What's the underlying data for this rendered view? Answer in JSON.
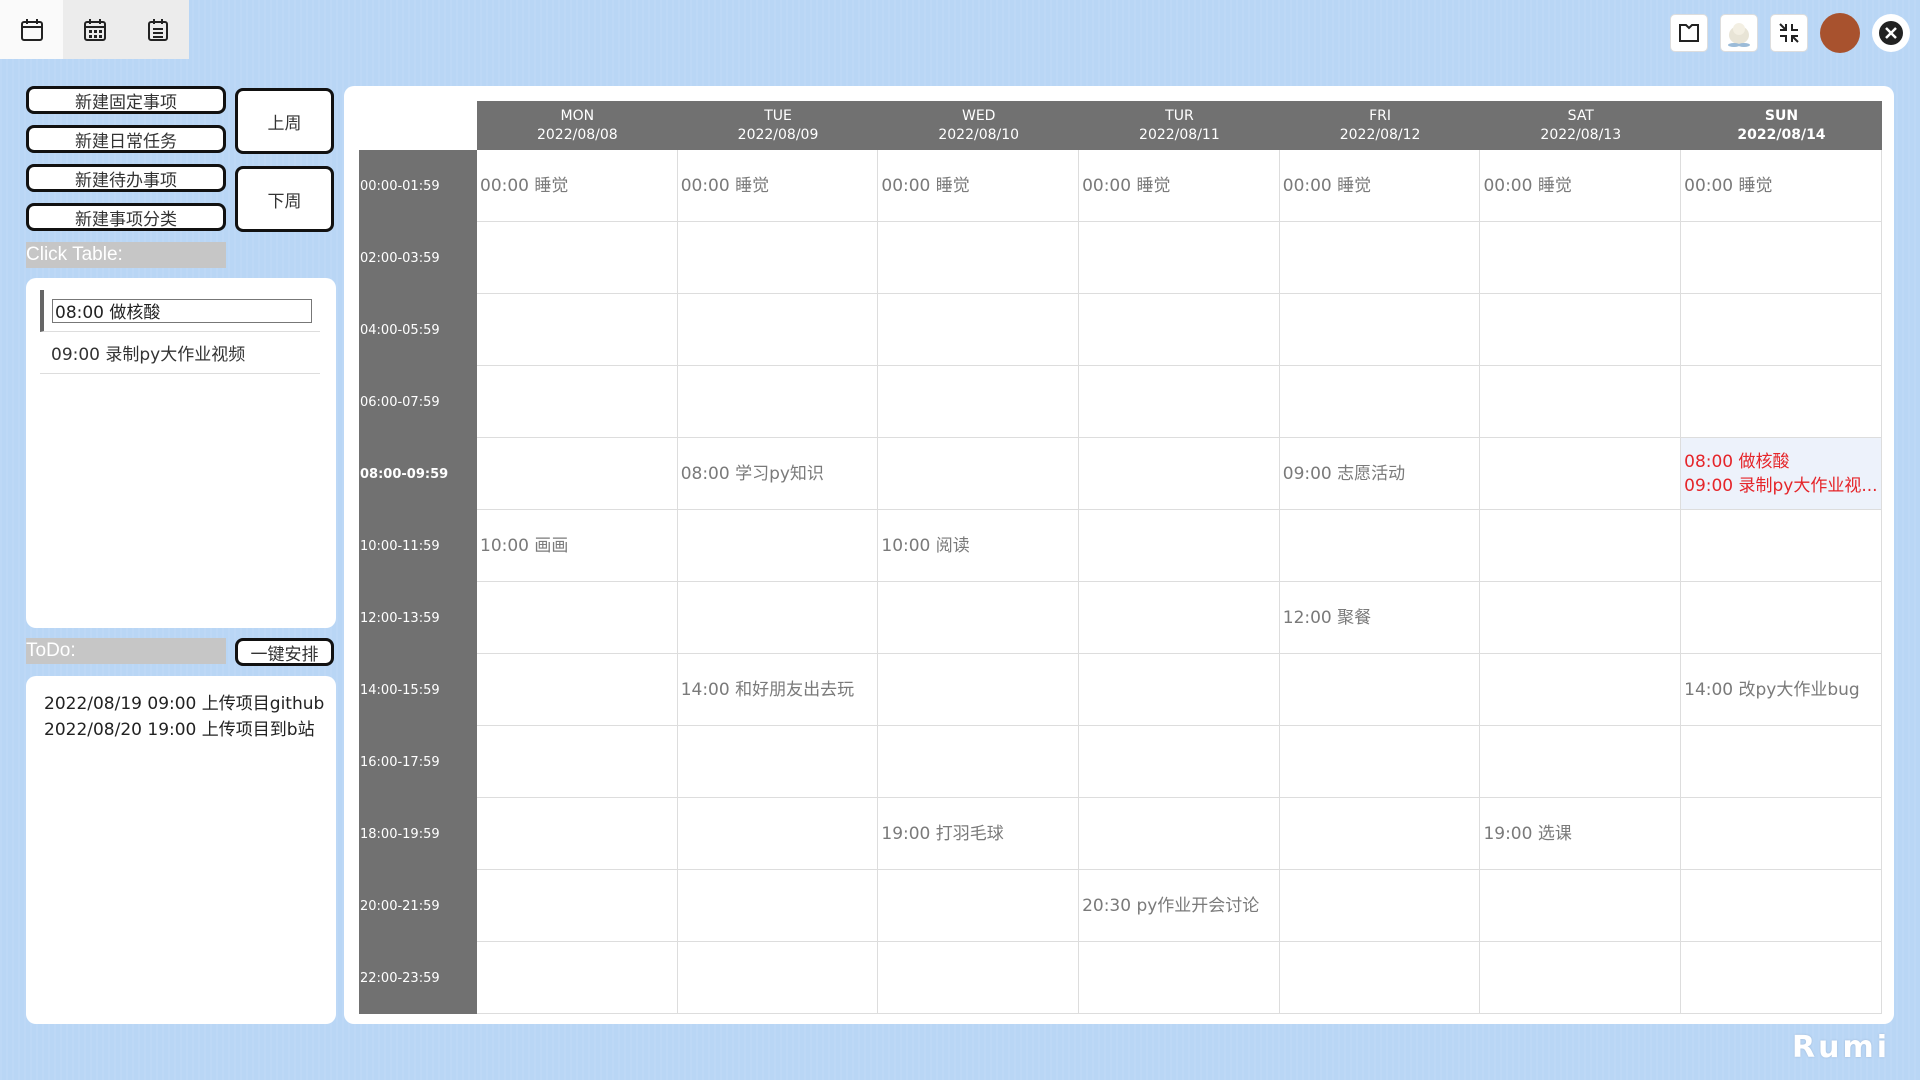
{
  "nav": {
    "icons": [
      "calendar-icon",
      "calendar-grid-icon",
      "list-calendar-icon"
    ]
  },
  "topright": {
    "icons": [
      "skin-icon",
      "pet-icon",
      "minimize-icon",
      "avatar",
      "close-icon"
    ],
    "avatar_color": "#a8522e"
  },
  "buttons": {
    "new_fixed": "新建固定事项",
    "new_daily": "新建日常任务",
    "new_todo": "新建待办事项",
    "new_category": "新建事项分类",
    "prev_week": "上周",
    "next_week": "下周",
    "arrange": "一键安排"
  },
  "click_table": {
    "label": "Click Table:",
    "items": [
      "08:00 做核酸",
      "09:00 录制py大作业视频"
    ]
  },
  "todo": {
    "label": "ToDo:",
    "items": [
      "2022/08/19 09:00 上传项目github",
      "2022/08/20 19:00 上传项目到b站"
    ]
  },
  "calendar": {
    "days": [
      {
        "name": "MON",
        "date": "2022/08/08"
      },
      {
        "name": "TUE",
        "date": "2022/08/09"
      },
      {
        "name": "WED",
        "date": "2022/08/10"
      },
      {
        "name": "TUR",
        "date": "2022/08/11"
      },
      {
        "name": "FRI",
        "date": "2022/08/12"
      },
      {
        "name": "SAT",
        "date": "2022/08/13"
      },
      {
        "name": "SUN",
        "date": "2022/08/14"
      }
    ],
    "today_index": 6,
    "highlight_row": 4,
    "time_slots": [
      "00:00-01:59",
      "02:00-03:59",
      "04:00-05:59",
      "06:00-07:59",
      "08:00-09:59",
      "10:00-11:59",
      "12:00-13:59",
      "14:00-15:59",
      "16:00-17:59",
      "18:00-19:59",
      "20:00-21:59",
      "22:00-23:59"
    ],
    "cells": [
      [
        [
          "00:00 睡觉"
        ],
        [
          "00:00 睡觉"
        ],
        [
          "00:00 睡觉"
        ],
        [
          "00:00 睡觉"
        ],
        [
          "00:00 睡觉"
        ],
        [
          "00:00 睡觉"
        ],
        [
          "00:00 睡觉"
        ]
      ],
      [
        [],
        [],
        [],
        [],
        [],
        [],
        []
      ],
      [
        [],
        [],
        [],
        [],
        [],
        [],
        []
      ],
      [
        [],
        [],
        [],
        [],
        [],
        [],
        []
      ],
      [
        [],
        [
          "08:00 学习py知识"
        ],
        [],
        [],
        [
          "09:00 志愿活动"
        ],
        [],
        [
          "08:00 做核酸",
          "09:00 录制py大作业视..."
        ]
      ],
      [
        [
          "10:00 画画"
        ],
        [],
        [
          "10:00 阅读"
        ],
        [],
        [],
        [],
        []
      ],
      [
        [],
        [],
        [],
        [],
        [
          "12:00 聚餐"
        ],
        [],
        []
      ],
      [
        [],
        [
          "14:00 和好朋友出去玩"
        ],
        [],
        [],
        [],
        [],
        [
          "14:00 改py大作业bug"
        ]
      ],
      [
        [],
        [],
        [],
        [],
        [],
        [],
        []
      ],
      [
        [],
        [],
        [
          "19:00 打羽毛球"
        ],
        [],
        [],
        [
          "19:00 选课"
        ],
        []
      ],
      [
        [],
        [],
        [],
        [
          "20:30 py作业开会讨论"
        ],
        [],
        [],
        []
      ],
      [
        [],
        [],
        [],
        [],
        [],
        [],
        []
      ]
    ]
  },
  "logo": "Rumi",
  "colors": {
    "background": "#b9d6f5",
    "header_gray": "#717171",
    "highlight_text": "#e5252a",
    "highlight_bg": "#edf2fb"
  }
}
